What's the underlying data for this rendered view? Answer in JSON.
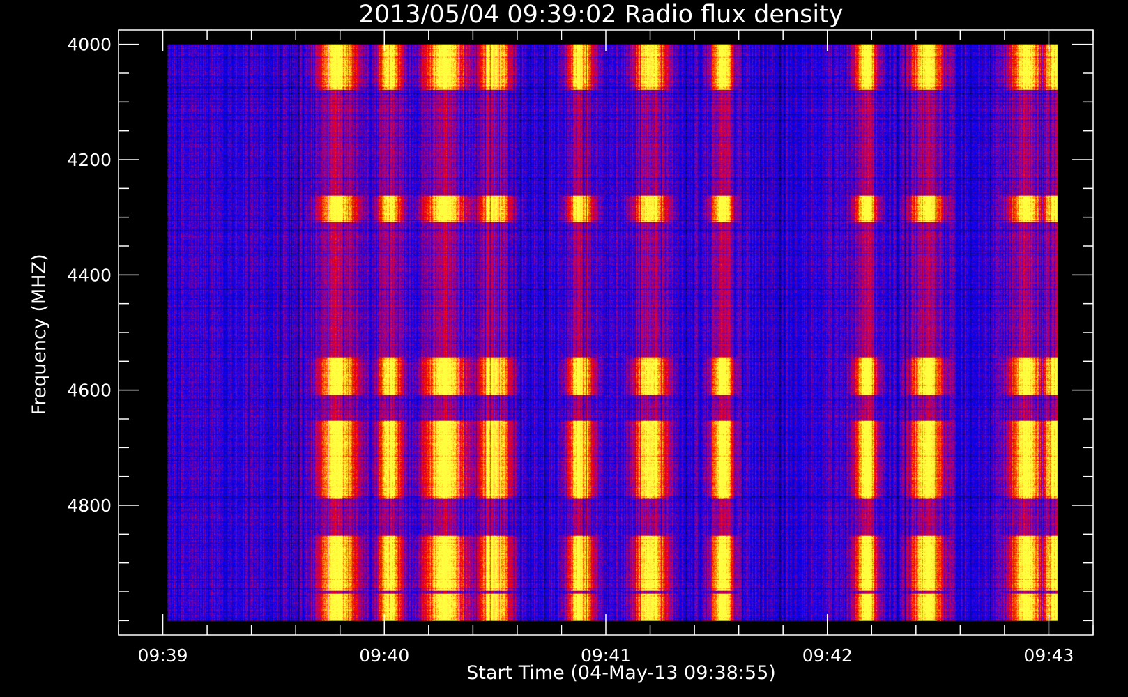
{
  "chart_data": {
    "type": "heatmap",
    "title": "2013/05/04 09:39:02 Radio flux density",
    "xlabel": "Start Time (04-May-13 09:38:55)",
    "ylabel": "Frequency (MHZ)",
    "x_ticks": [
      "09:39",
      "09:40",
      "09:41",
      "09:42",
      "09:43"
    ],
    "x_tick_minutes": [
      0,
      1,
      2,
      3,
      4
    ],
    "x_minor_step_minutes": 0.2,
    "y_ticks": [
      4000,
      4200,
      4400,
      4600,
      4800
    ],
    "y_minor_step": 50,
    "xlim_minutes": [
      -0.2,
      4.2
    ],
    "ylim": [
      5025,
      3975
    ],
    "data_x_range_minutes": [
      0.02,
      4.04
    ],
    "data_y_range": [
      4000,
      5000
    ],
    "grid": false,
    "colormap": [
      "#000000",
      "#1a0a70",
      "#0000ff",
      "#b0007a",
      "#ff0000",
      "#ff8a00",
      "#ffff40"
    ],
    "background_color": "#000000",
    "axis_color": "#ffffff",
    "bright_bands_mhz": [
      [
        4000,
        4070
      ],
      [
        4270,
        4300
      ],
      [
        4550,
        4600
      ],
      [
        4660,
        4780
      ],
      [
        4860,
        4940
      ],
      [
        4960,
        5000
      ]
    ],
    "bright_periods_minutes": [
      [
        0.73,
        0.85
      ],
      [
        1.0,
        1.05
      ],
      [
        1.2,
        1.35
      ],
      [
        1.45,
        1.55
      ],
      [
        1.85,
        1.92
      ],
      [
        2.15,
        2.25
      ],
      [
        2.5,
        2.55
      ],
      [
        3.15,
        3.2
      ],
      [
        3.4,
        3.5
      ],
      [
        3.85,
        3.95
      ],
      [
        4.0,
        4.04
      ]
    ]
  }
}
